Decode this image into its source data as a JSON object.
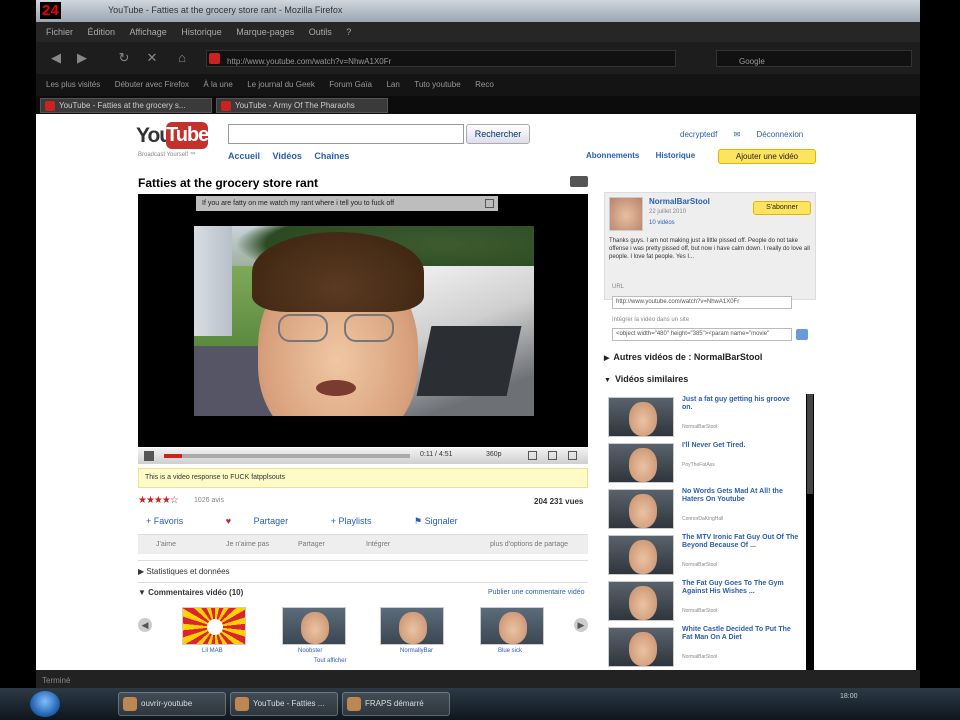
{
  "dock": {
    "logo": "24",
    "text": "YouTube - Fatties at the grocery store rant - Mozilla Firefox"
  },
  "browser": {
    "menu": [
      "Fichier",
      "Édition",
      "Affichage",
      "Historique",
      "Marque-pages",
      "Outils",
      "?"
    ],
    "url": "http://www.youtube.com/watch?v=NhwA1X0Fr",
    "search_engine": "Google",
    "bookmarks": [
      "Les plus visités",
      "Débuter avec Firefox",
      "À la une",
      "Le journal du Geek",
      "Forum Gaïa",
      "Lan",
      "Tuto youtube",
      "Reco"
    ],
    "tabs": [
      "YouTube - Fatties at the grocery s...",
      "YouTube - Army Of The Pharaohs"
    ]
  },
  "youtube": {
    "logo_you": "You",
    "logo_tube": "Tube",
    "tagline": "Broadcast Yourself ™",
    "search_placeholder": "",
    "search_button": "Rechercher",
    "nav": [
      "Accueil",
      "Vidéos",
      "Chaînes"
    ],
    "account": [
      "decryptedf",
      "Déconnexion"
    ],
    "sublinks": [
      "Abonnements",
      "Historique"
    ],
    "add_video": "Ajouter une vidéo"
  },
  "video": {
    "title": "Fatties at the grocery store rant",
    "banner": "If you are fatty on me watch my rant where i tell you to fuck off",
    "time": "0:11 / 4:51",
    "quality": "360p",
    "response": "This is a video response to FUCK fatpplsouts",
    "stars": "★★★★☆",
    "ratings": "1026 avis",
    "views": "204 231 vues",
    "actions": [
      "Favoris",
      "Partager",
      "Playlists",
      "Signaler"
    ],
    "share_links": [
      "J'aime",
      "Je n'aime pas",
      "Partager",
      "Intégrer"
    ],
    "share_right": "plus d'options de partage",
    "stats": "Statistiques et données",
    "comments": "Commentaires vidéo (10)",
    "comments_link": "Publier une commentaire vidéo",
    "responses": [
      {
        "label": "Lil MAB"
      },
      {
        "label": "Noobster"
      },
      {
        "label": "NormallyBar"
      },
      {
        "label": "Blue sick"
      }
    ],
    "more_label": "Tout afficher"
  },
  "uploader": {
    "name": "NormalBarStool",
    "date": "22 juillet 2010",
    "videos": "10 vidéos",
    "subscribe": "S'abonner",
    "description": "Thanks guys. I am not making just a little pissed off. People do not take offense i was pretty pissed off, but now i have calm down. I really do love all people. I love fat people. Yes I...",
    "url_label": "URL",
    "url": "http://www.youtube.com/watch?v=NhwA1X0Fr",
    "embed_label": "Intégrer la vidéo dans un site",
    "embed": "<object width=\"480\" height=\"385\"><param name=\"movie\""
  },
  "right": {
    "other_videos": "Autres vidéos de : NormalBarStool",
    "similar": "Vidéos similaires",
    "related": [
      {
        "title": "Just a fat guy getting his groove on.",
        "meta": "NormalBarStool"
      },
      {
        "title": "I'll Never Get Tired.",
        "meta": "PoyTheFatAss"
      },
      {
        "title": "No Words Gets Mad At All! the Haters On Youtube",
        "meta": "ConnorDaKingHall"
      },
      {
        "title": "The MTV Ironic Fat Guy Out Of The Beyond Because Of ...",
        "meta": "NormalBarStool"
      },
      {
        "title": "The Fat Guy Goes To The Gym Against His Wishes ...",
        "meta": "NormalBarStool"
      },
      {
        "title": "White Castle Decided To Put The Fat Man On A Diet",
        "meta": "NormalBarStool"
      }
    ]
  },
  "status": "Terminé",
  "taskbar": [
    "ouvrir-youtube",
    "YouTube - Fatties ...",
    "FRAPS démarré"
  ],
  "tray": {
    "time": "18:00"
  }
}
